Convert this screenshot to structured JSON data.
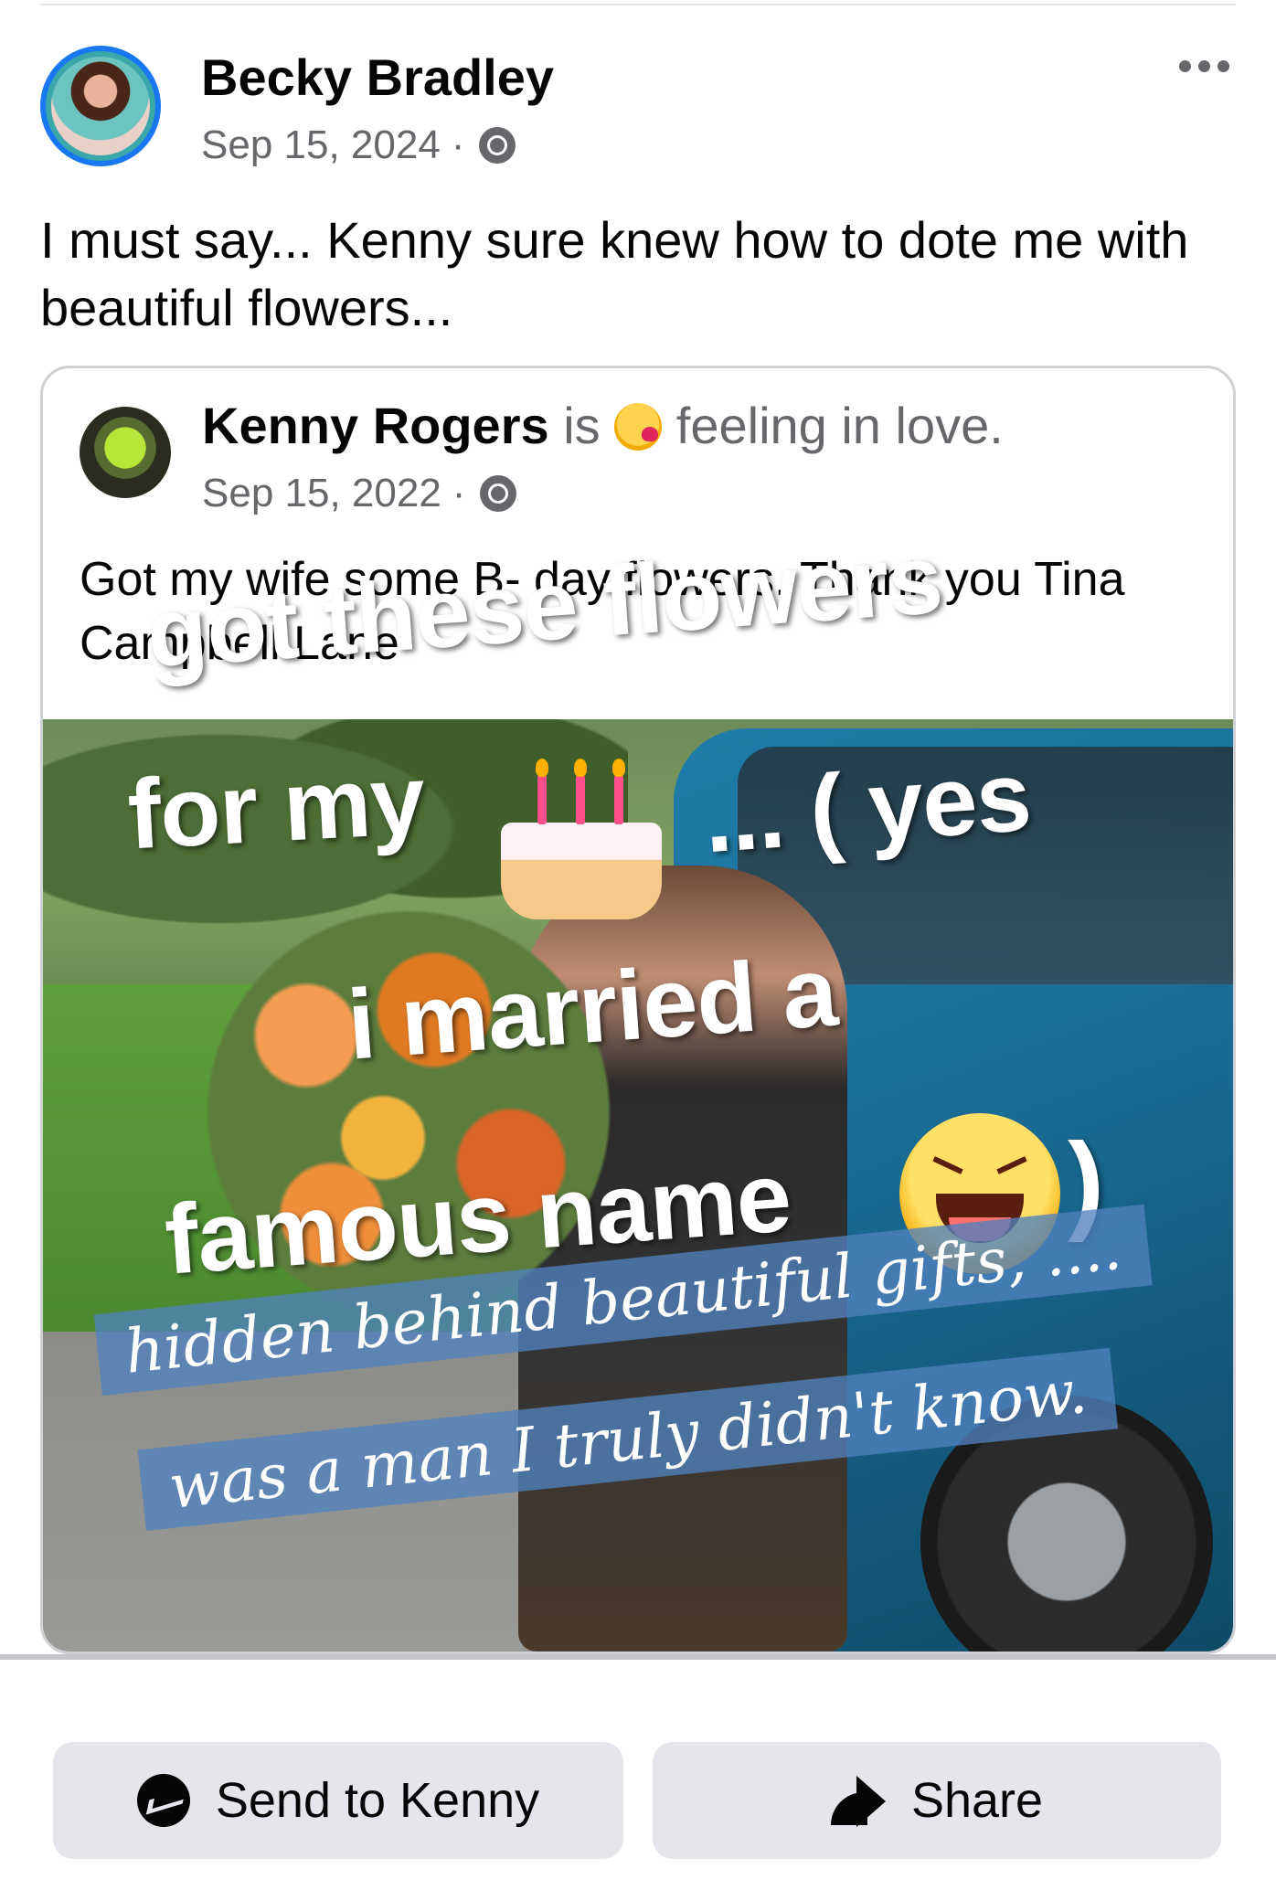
{
  "post": {
    "author": "Becky Bradley",
    "date": "Sep 15, 2024",
    "separator": "·",
    "privacy_icon": "globe-icon",
    "text": "I must say... Kenny  sure knew how to dote me with beautiful  flowers..."
  },
  "shared": {
    "author": "Kenny Rogers",
    "is_word": "is",
    "feeling_emoji": "smiling-face-with-hearts",
    "feeling": "feeling in love.",
    "date": "Sep 15, 2022",
    "separator": "·",
    "text": "Got my wife some B- day flowers.   Thank you Tina Campbell Lane"
  },
  "photo_overlay": {
    "line1": "got these flowers",
    "line2_a": "for my",
    "line2_b": "... ( yes",
    "line3": "i married a",
    "line4": "famous name",
    "line4_close": ")",
    "banner1": "hidden  behind beautiful gifts, ....",
    "banner2": "was a man I truly didn't know."
  },
  "actions": {
    "send_label": "Send to Kenny",
    "share_label": "Share"
  },
  "colors": {
    "accent": "#1877f2",
    "button_bg": "#e4e6eb",
    "meta_text": "#65676b"
  }
}
